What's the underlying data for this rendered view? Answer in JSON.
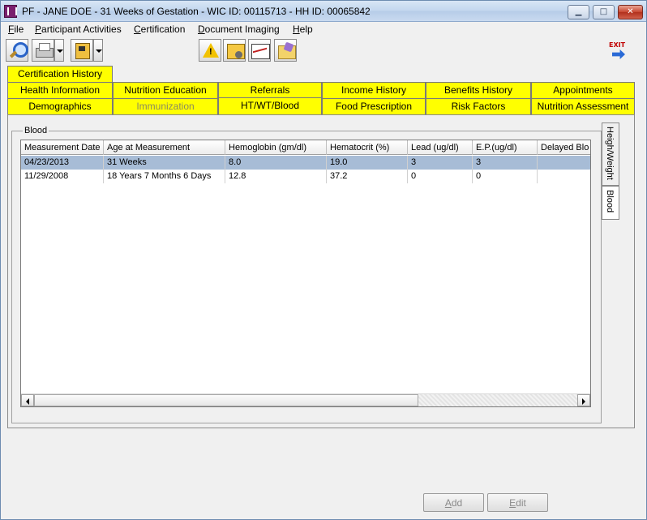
{
  "window": {
    "title": "PF - JANE DOE - 31 Weeks of Gestation - WIC ID: 00115713 - HH ID: 00065842",
    "minimize": "▁",
    "maximize": "□",
    "close": "✕"
  },
  "menu": [
    {
      "accel": "F",
      "rest": "ile"
    },
    {
      "accel": "P",
      "rest": "articipant Activities"
    },
    {
      "accel": "C",
      "rest": "ertification"
    },
    {
      "accel": "D",
      "rest": "ocument Imaging"
    },
    {
      "accel": "H",
      "rest": "elp"
    }
  ],
  "toolbar": {
    "exit_label": "EXIT",
    "icons": [
      "magnify-icon",
      "printer-icon",
      "scale-icon",
      "warning-icon",
      "note-icon",
      "graph-icon",
      "folder-icon",
      "exit-icon"
    ]
  },
  "tabs": {
    "row1": [
      "Certification History"
    ],
    "row2": [
      "Health Information",
      "Nutrition Education",
      "Referrals",
      "Income History",
      "Benefits History",
      "Appointments"
    ],
    "row3": [
      "Demographics",
      "Immunization",
      "HT/WT/Blood",
      "Food Prescription",
      "Risk Factors",
      "Nutrition Assessment"
    ],
    "active": "HT/WT/Blood",
    "disabled": "Immunization"
  },
  "blood": {
    "group_label": "Blood",
    "columns": [
      "Measurement Date",
      "Age at Measurement",
      "Hemoglobin (gm/dl)",
      "Hematocrit (%)",
      "Lead (ug/dl)",
      "E.P.(ug/dl)",
      "Delayed Blo"
    ],
    "rows": [
      [
        "04/23/2013",
        "31 Weeks",
        "8.0",
        "19.0",
        "3",
        "3",
        ""
      ],
      [
        "11/29/2008",
        "18 Years 7 Months 6 Days",
        "12.8",
        "37.2",
        "0",
        "0",
        ""
      ]
    ]
  },
  "side_tabs": [
    "Heigh/Weight",
    "Blood"
  ],
  "buttons": {
    "add": {
      "accel": "A",
      "rest": "dd"
    },
    "edit": {
      "accel": "E",
      "rest": "dit"
    }
  },
  "colors": {
    "tab_yellow": "#ffff00",
    "selected_row": "#a7bcd6"
  }
}
